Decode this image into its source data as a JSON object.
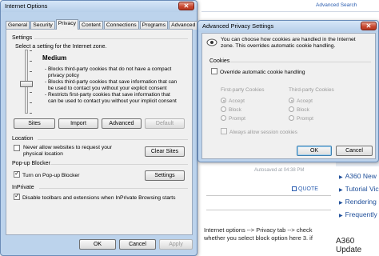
{
  "background": {
    "advanced_search": "Advanced Search",
    "sidebar_links": [
      "A360 New",
      "Tutorial Vic",
      "Rendering",
      "Frequently"
    ],
    "faded_text": "Autosaved at 04:38 PM",
    "quote": "QUOTE",
    "body_lines": [
      "Internet options --> Privacy tab --> check",
      "whether you select block option here 3. if"
    ],
    "a360_heading": "A360 Update"
  },
  "internet_options": {
    "title": "Internet Options",
    "tabs": [
      "General",
      "Security",
      "Privacy",
      "Content",
      "Connections",
      "Programs",
      "Advanced"
    ],
    "active_tab": "Privacy",
    "settings_label": "Settings",
    "select_zone_text": "Select a setting for the Internet zone.",
    "level": "Medium",
    "description_lines": [
      "- Blocks third-party cookies that do not have a compact",
      "privacy policy",
      "- Blocks third-party cookies that save information that can",
      "be used to contact you without your explicit consent",
      "- Restricts first-party cookies that save information that",
      "can be used to contact you without your implicit consent"
    ],
    "buttons": {
      "sites": "Sites",
      "import": "Import",
      "advanced": "Advanced",
      "default": "Default"
    },
    "location_label": "Location",
    "never_allow_lines": [
      "Never allow websites to request your",
      "physical location"
    ],
    "clear_sites": "Clear Sites",
    "popup_label": "Pop-up Blocker",
    "turn_on_popup": "Turn on Pop-up Blocker",
    "settings_button": "Settings",
    "inprivate_label": "InPrivate",
    "disable_toolbars": "Disable toolbars and extensions when InPrivate Browsing starts",
    "footer": {
      "ok": "OK",
      "cancel": "Cancel",
      "apply": "Apply"
    }
  },
  "advanced_privacy": {
    "title": "Advanced Privacy Settings",
    "info_lines": [
      "You can choose how cookies are handled in the Internet",
      "zone.  This overrides automatic cookie handling."
    ],
    "cookies_label": "Cookies",
    "override_label": "Override automatic cookie handling",
    "first_party_label": "First-party Cookies",
    "third_party_label": "Third-party Cookies",
    "options": [
      "Accept",
      "Block",
      "Prompt"
    ],
    "session_cookies": "Always allow session cookies",
    "ok": "OK",
    "cancel": "Cancel"
  },
  "colors": {
    "window_frame": "#bcd3ec",
    "close_button": "#c8452c",
    "link": "#1f4f9a"
  }
}
